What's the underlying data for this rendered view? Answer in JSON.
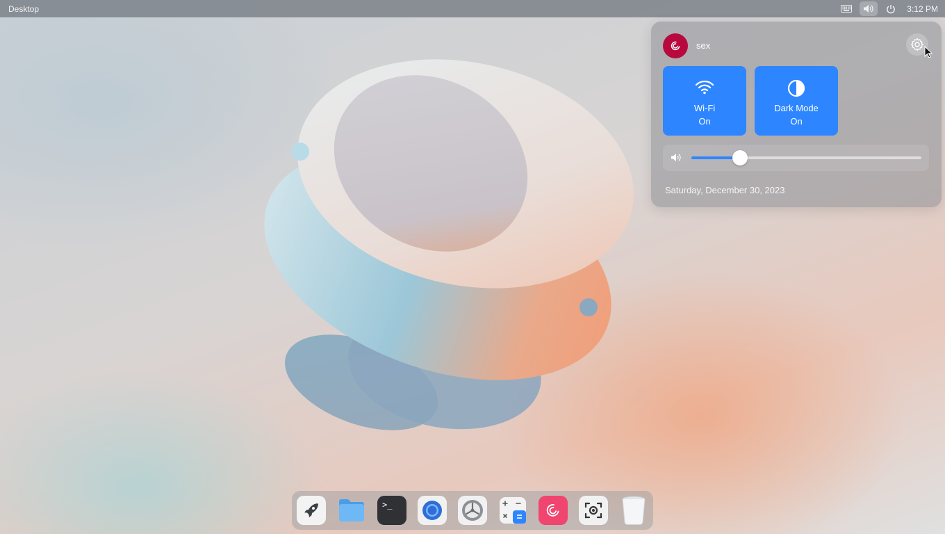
{
  "top_bar": {
    "title": "Desktop",
    "clock": "3:12 PM",
    "tray_icons": [
      "keyboard-icon",
      "volume-icon",
      "power-icon"
    ]
  },
  "quick_settings": {
    "username": "sex",
    "tiles": [
      {
        "icon": "wifi-icon",
        "label": "Wi-Fi",
        "state": "On"
      },
      {
        "icon": "dark-mode-icon",
        "label": "Dark Mode",
        "state": "On"
      }
    ],
    "volume_level": 0.21,
    "date": "Saturday, December 30, 2023"
  },
  "dock": {
    "items": [
      "launcher-icon",
      "files-icon",
      "terminal-icon",
      "browser-icon",
      "system-settings-icon",
      "calculator-icon",
      "debian-icon",
      "screenshot-icon",
      "trash-icon"
    ],
    "terminal_prompt": ">_"
  },
  "colors": {
    "accent": "#2d86ff",
    "avatar": "#b8093f"
  }
}
